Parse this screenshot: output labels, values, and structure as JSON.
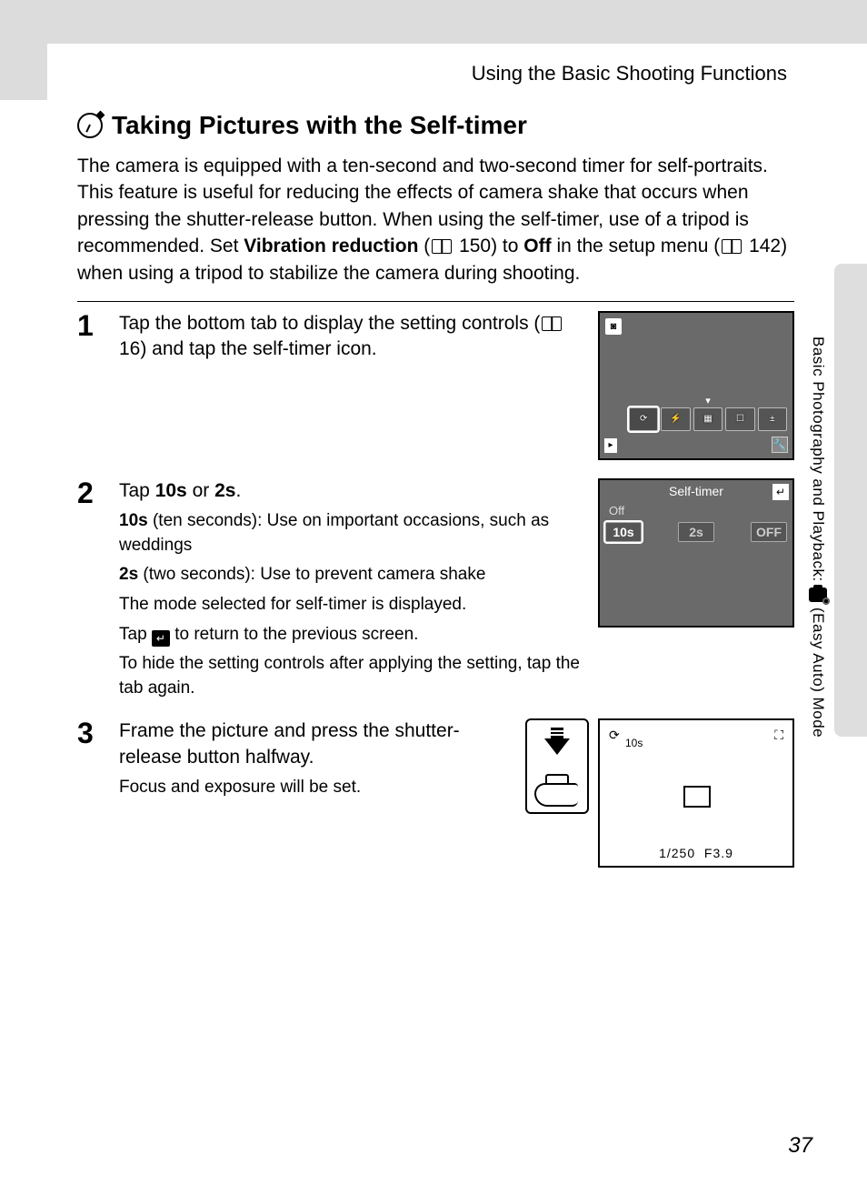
{
  "section_header": "Using the Basic Shooting Functions",
  "title": "Taking Pictures with the Self-timer",
  "intro": {
    "t1": "The camera is equipped with a ten-second and two-second timer for self-portraits. This feature is useful for reducing the effects of camera shake that occurs when pressing the shutter-release button. When using the self-timer, use of a tripod is recommended. Set ",
    "vr": "Vibration reduction",
    "t2": " (",
    "p150": " 150) to ",
    "off": "Off",
    "t3": " in the setup menu (",
    "p142": " 142) when using a tripod to stabilize the camera during shooting."
  },
  "steps": {
    "s1": {
      "num": "1",
      "title_a": "Tap the bottom tab to display the setting controls (",
      "p16": " 16) and tap the self-timer icon."
    },
    "s2": {
      "num": "2",
      "title_a": "Tap ",
      "b10s": "10s",
      "or": " or ",
      "b2s": "2s",
      "dot": ".",
      "line1a": "10s",
      "line1b": " (ten seconds): Use on important occasions, such as weddings",
      "line2a": "2s",
      "line2b": " (two seconds): Use to prevent camera shake",
      "line3": "The mode selected for self-timer is displayed.",
      "line4a": "Tap ",
      "line4b": " to return to the previous screen.",
      "line5": "To hide the setting controls after applying the setting, tap the tab again."
    },
    "s3": {
      "num": "3",
      "title": "Frame the picture and press the shutter-release button halfway.",
      "sub": "Focus and exposure will be set."
    }
  },
  "lcd2": {
    "header": "Self-timer",
    "off": "Off",
    "opt1": "10s",
    "opt2": "2s",
    "opt3": "OFF"
  },
  "lcd3": {
    "timer": "10s",
    "shutter": "1/250",
    "aperture": "F3.9"
  },
  "side_label_a": "Basic Photography and Playback: ",
  "side_label_b": " (Easy Auto) Mode",
  "page_number": "37"
}
